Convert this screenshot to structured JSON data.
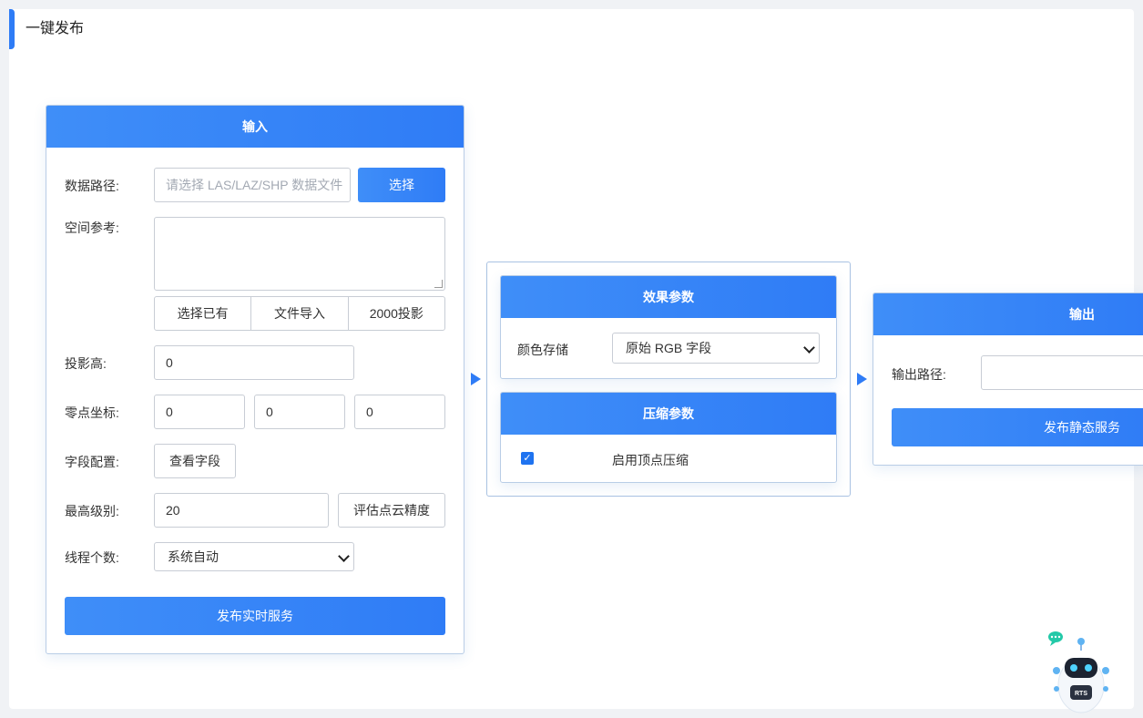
{
  "page_title": "一键发布",
  "input_card": {
    "header": "输入",
    "data_path": {
      "label": "数据路径:",
      "placeholder": "请选择 LAS/LAZ/SHP 数据文件",
      "value": "",
      "button": "选择"
    },
    "spatial_ref": {
      "label": "空间参考:",
      "value": "",
      "buttons": [
        "选择已有",
        "文件导入",
        "2000投影"
      ]
    },
    "proj_height": {
      "label": "投影高:",
      "value": "0"
    },
    "origin": {
      "label": "零点坐标:",
      "x": "0",
      "y": "0",
      "z": "0"
    },
    "fields": {
      "label": "字段配置:",
      "button": "查看字段"
    },
    "max_level": {
      "label": "最高级别:",
      "value": "20",
      "button": "评估点云精度"
    },
    "threads": {
      "label": "线程个数:",
      "selected": "系统自动"
    },
    "publish_button": "发布实时服务"
  },
  "effect_card": {
    "header": "效果参数",
    "color_storage": {
      "label": "颜色存储",
      "selected": "原始 RGB 字段"
    }
  },
  "compress_card": {
    "header": "压缩参数",
    "vertex_compress": {
      "label": "启用顶点压缩",
      "checked": true
    }
  },
  "output_card": {
    "header": "输出",
    "output_path": {
      "label": "输出路径:",
      "value": ""
    },
    "publish_button": "发布静态服务"
  },
  "robot": {
    "badge": "RTS"
  },
  "colors": {
    "accent": "#2f7cf6",
    "border": "#b9cde6"
  }
}
